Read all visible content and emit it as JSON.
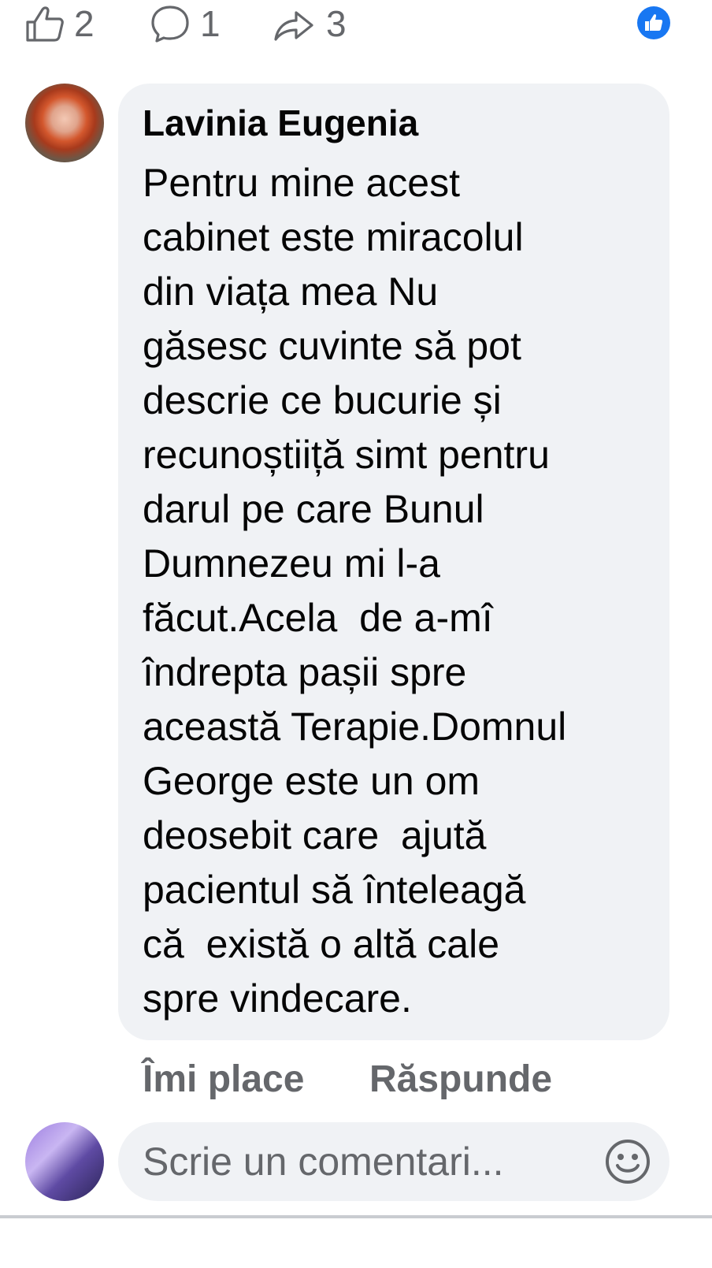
{
  "post_actions": {
    "like_count": "2",
    "comment_count": "1",
    "share_count": "3"
  },
  "icons": {
    "like": "thumbs-up-outline-icon",
    "comment": "speech-bubble-icon",
    "share": "share-arrow-icon",
    "reaction_badge": "like-reaction-icon",
    "emoji": "smiley-icon"
  },
  "colors": {
    "reaction_blue": "#1877f2",
    "bubble_bg": "#f0f2f5",
    "secondary_text": "#65676b",
    "primary_text": "#050505"
  },
  "comment": {
    "author": "Lavinia Eugenia",
    "lines": [
      "Pentru mine acest",
      "cabinet este miracolul",
      "din viața mea Nu",
      "găsesc cuvinte să pot",
      "descrie ce bucurie și",
      "recunoștiiță simt pentru",
      "darul pe care Bunul",
      "Dumnezeu mi l-a",
      "făcut.Acela  de a-mî",
      "îndrepta pașii spre",
      "această Terapie.Domnul",
      "George este un om",
      "deosebit care  ajută",
      "pacientul să înteleagă",
      "că  există o altă cale",
      "spre vindecare."
    ],
    "like_label": "Îmi place",
    "reply_label": "Răspunde"
  },
  "composer": {
    "placeholder": "Scrie un comentari..."
  }
}
